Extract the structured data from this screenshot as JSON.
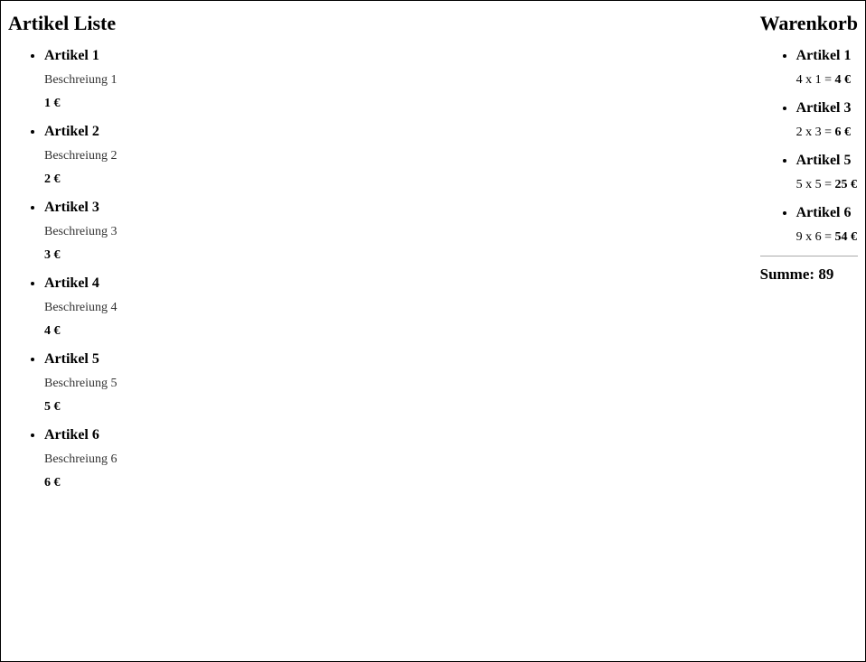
{
  "articleList": {
    "title": "Artikel Liste",
    "items": [
      {
        "name": "Artikel 1",
        "description": "Beschreiung 1",
        "price": "1 €"
      },
      {
        "name": "Artikel 2",
        "description": "Beschreiung 2",
        "price": "2 €"
      },
      {
        "name": "Artikel 3",
        "description": "Beschreiung 3",
        "price": "3 €"
      },
      {
        "name": "Artikel 4",
        "description": "Beschreiung 4",
        "price": "4 €"
      },
      {
        "name": "Artikel 5",
        "description": "Beschreiung 5",
        "price": "5 €"
      },
      {
        "name": "Artikel 6",
        "description": "Beschreiung 6",
        "price": "6 €"
      }
    ]
  },
  "cart": {
    "title": "Warenkorb",
    "items": [
      {
        "name": "Artikel 1",
        "qty": "4",
        "unit": "1",
        "total": "4 €"
      },
      {
        "name": "Artikel 3",
        "qty": "2",
        "unit": "3",
        "total": "6 €"
      },
      {
        "name": "Artikel 5",
        "qty": "5",
        "unit": "5",
        "total": "25 €"
      },
      {
        "name": "Artikel 6",
        "qty": "9",
        "unit": "6",
        "total": "54 €"
      }
    ],
    "sumLabel": "Summe:",
    "sumValue": "89"
  }
}
